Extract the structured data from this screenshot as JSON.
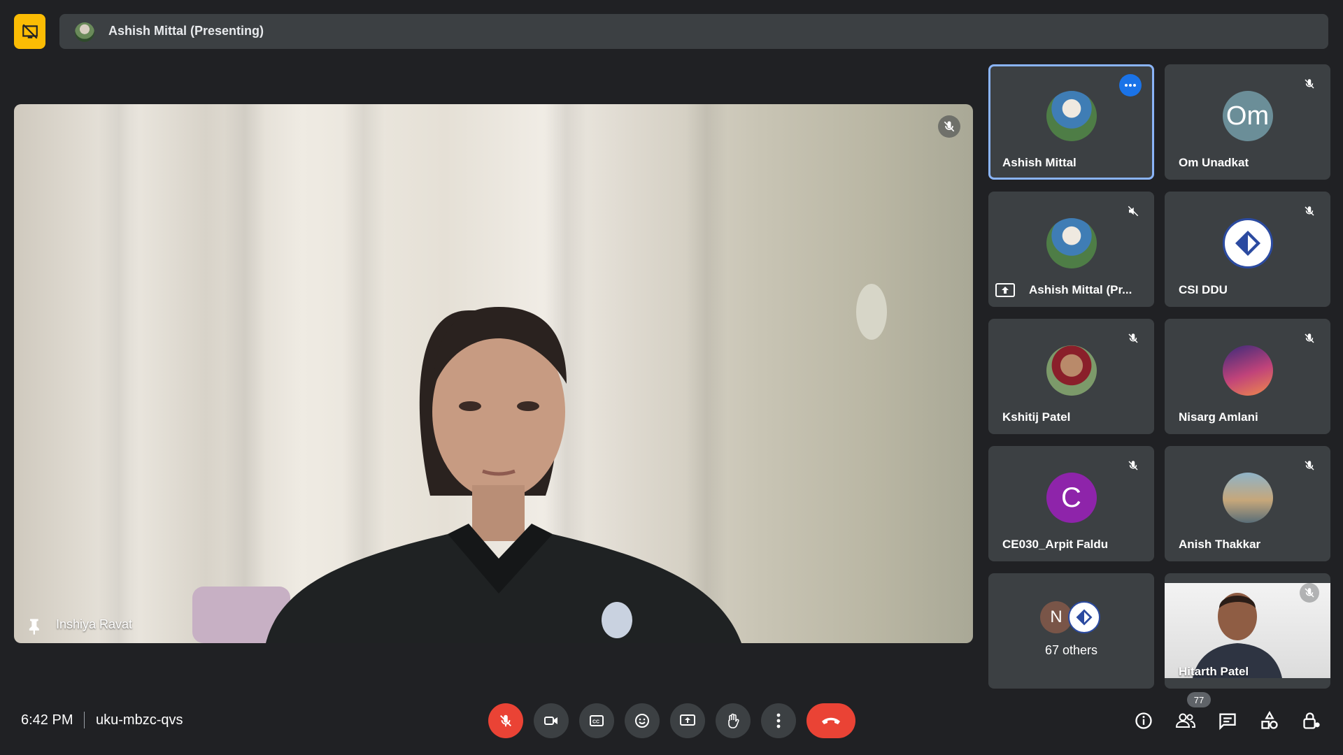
{
  "presenting": {
    "label": "Ashish Mittal (Presenting)",
    "icon": "stop-presenting-icon"
  },
  "main_video": {
    "name": "Inshiya Ravat"
  },
  "tiles": [
    {
      "name": "Ashish Mittal",
      "active": true
    },
    {
      "name": "Om Unadkat",
      "initials": "Om"
    },
    {
      "name": "Ashish Mittal (Pr...",
      "icon": "present-screen-icon"
    },
    {
      "name": "CSI DDU"
    },
    {
      "name": "Kshitij Patel"
    },
    {
      "name": "Nisarg Amlani"
    },
    {
      "name": "CE030_Arpit Faldu",
      "initials": "C"
    },
    {
      "name": "Anish Thakkar"
    },
    {
      "name": "67 others",
      "initials": "N"
    },
    {
      "name": "Hitarth Patel"
    }
  ],
  "bottom": {
    "time": "6:42 PM",
    "meeting_code": "uku-mbzc-qvs",
    "participant_count": "77"
  },
  "colors": {
    "end_call": "#ea4335",
    "active_outline": "#8ab4f8",
    "badge": "#fbbc04",
    "background": "#202124"
  }
}
